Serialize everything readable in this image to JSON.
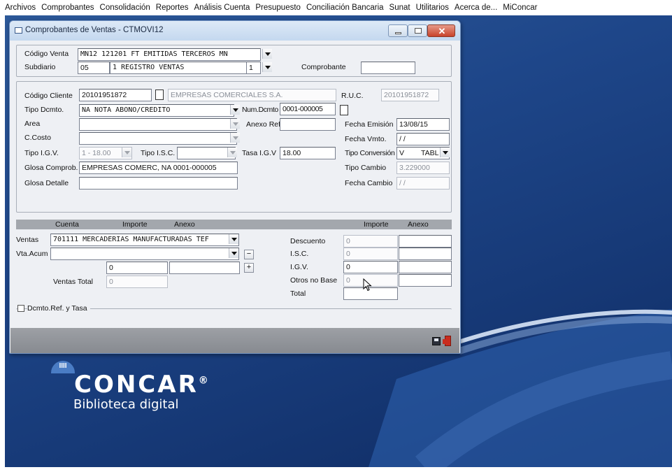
{
  "menu": [
    "Archivos",
    "Comprobantes",
    "Consolidación",
    "Reportes",
    "Análisis Cuenta",
    "Presupuesto",
    "Conciliación Bancaria",
    "Sunat",
    "Utilitarios",
    "Acerca de...",
    "MiConcar"
  ],
  "window": {
    "title": "Comprobantes de Ventas - CTMOVI12",
    "close_glyph": "✕"
  },
  "header": {
    "codigo_venta_label": "Código Venta",
    "codigo_venta_value": "MN12   121201   FT EMITIDAS TERCEROS MN",
    "subdiario_label": "Subdiario",
    "subdiario_code": "05",
    "subdiario_desc": "1  REGISTRO VENTAS",
    "subdiario_num": "1",
    "comprobante_label": "Comprobante",
    "comprobante_value": ""
  },
  "cliente": {
    "codigo_cliente_label": "Código Cliente",
    "codigo_cliente_value": "20101951872",
    "razon_social": "EMPRESAS COMERCIALES S.A.",
    "ruc_label": "R.U.C.",
    "ruc_value": "20101951872",
    "tipo_dcmto_label": "Tipo Dcmto.",
    "tipo_dcmto_value": "NA      NOTA ABONO/CREDITO",
    "num_dcmto_label": "Num.Dcmto",
    "num_dcmto_value": "0001-000005",
    "area_label": "Area",
    "anexo_ref_label": "Anexo Ref.",
    "fecha_emision_label": "Fecha Emisión",
    "fecha_emision_value": "13/08/15",
    "ccosto_label": "C.Costo",
    "fecha_vmto_label": "Fecha Vmto.",
    "fecha_vmto_value": "/ /",
    "tipo_igv_label": "Tipo I.G.V.",
    "tipo_igv_value": "1 - 18.00",
    "tipo_isc_label": "Tipo I.S.C.",
    "tasa_igv_label": "Tasa I.G.V",
    "tasa_igv_value": "18.00",
    "tipo_conversion_label": "Tipo Conversión",
    "tipo_conversion_code": "V",
    "tipo_conversion_value": "TABL",
    "glosa_comprob_label": "Glosa Comprob.",
    "glosa_comprob_value": "EMPRESAS COMERC, NA 0001-000005",
    "tipo_cambio_label": "Tipo Cambio",
    "tipo_cambio_value": "3.229000",
    "glosa_detalle_label": "Glosa Detalle",
    "glosa_detalle_value": "",
    "fecha_cambio_label": "Fecha Cambio",
    "fecha_cambio_value": "/ /"
  },
  "grid": {
    "col_cuenta": "Cuenta",
    "col_importe": "Importe",
    "col_anexo": "Anexo",
    "col_importe2": "Importe",
    "col_anexo2": "Anexo"
  },
  "detalle": {
    "ventas_label": "Ventas",
    "ventas_value": "701111   MERCADERIAS MANUFACTURADAS TEF",
    "vta_acum_label": "Vta.Acum",
    "minus_btn": "−",
    "plus_btn": "+",
    "importe_value": "0",
    "ventas_total_label": "Ventas Total",
    "ventas_total_value": "0",
    "descuento_label": "Descuento",
    "descuento_value": "0",
    "isc_label": "I.S.C.",
    "isc_value": "0",
    "igv_label": "I.G.V.",
    "igv_value": "0",
    "otros_label": "Otros no Base",
    "otros_value": "0",
    "total_label": "Total",
    "total_value": ""
  },
  "dcmto_ref": {
    "label": "Dcmto.Ref. y Tasa",
    "checked": false
  },
  "logo": {
    "mark": "IIII",
    "brand": "CONCAR",
    "registered": "®",
    "subtitle": "Biblioteca digital"
  },
  "icons": [
    "window-icon",
    "new-document-icon",
    "save-icon",
    "exit-door-icon",
    "mouse-cursor-icon"
  ]
}
